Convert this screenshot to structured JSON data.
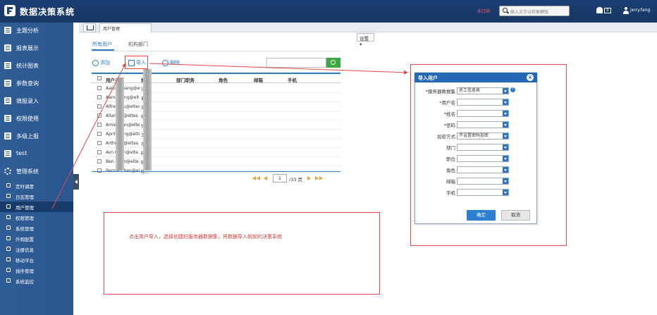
{
  "app": {
    "title": "数据决策系统"
  },
  "header": {
    "alert_text": "未订阅",
    "search_placeholder": "输入文字以检索模版",
    "notif_count": "0",
    "username": "jerry.fang"
  },
  "sidebar": {
    "items": [
      {
        "label": "主题分析"
      },
      {
        "label": "报表展示"
      },
      {
        "label": "统计图表"
      },
      {
        "label": "参数查询"
      },
      {
        "label": "填报录入"
      },
      {
        "label": "权限使用"
      },
      {
        "label": "多级上报"
      },
      {
        "label": "test"
      },
      {
        "label": "管理系统"
      }
    ],
    "subitems": [
      {
        "label": "定时调度"
      },
      {
        "label": "日志管理"
      },
      {
        "label": "用户管理"
      },
      {
        "label": "权限管理"
      },
      {
        "label": "系统管理"
      },
      {
        "label": "外观配置"
      },
      {
        "label": "注册信息"
      },
      {
        "label": "移动平台"
      },
      {
        "label": "插件管理"
      },
      {
        "label": "系统监控"
      }
    ]
  },
  "tabs": {
    "current": "用户管理"
  },
  "settings_label": "设置",
  "subtabs": {
    "all_users": "所有用户",
    "org_dept": "机构部门"
  },
  "toolbar": {
    "add": "添加",
    "import": "导入",
    "delete": "删除"
  },
  "table": {
    "headers": {
      "username": "用户名",
      "name": "姓名",
      "dept": "部门职务",
      "role": "角色",
      "email": "邮箱",
      "phone": "手机"
    },
    "rows": [
      {
        "username": "Aaron.Zhang@elt...",
        "name": "张..."
      },
      {
        "username": "Aaron.Yeng@elt...",
        "name": "黄..."
      },
      {
        "username": "Alfred.Liu@eltes...",
        "name": "刘..."
      },
      {
        "username": "Allan.Ng@eltes...",
        "name": "杨..."
      },
      {
        "username": "Amie.Qian@eltes...",
        "name": "钱..."
      },
      {
        "username": "April.Wang@eltes...",
        "name": "王..."
      },
      {
        "username": "Arthur.Li@eltes...",
        "name": "李..."
      },
      {
        "username": "Avn.Chen@elte...",
        "name": "陈..."
      },
      {
        "username": "Ben.Chen@elte...",
        "name": "陈..."
      },
      {
        "username": "Bernie.Chen@elt...",
        "name": "陈..."
      }
    ]
  },
  "pager": {
    "current": "1",
    "total_label": "/33 页"
  },
  "note": "点击用户导入，选择创建的服务器数据集，将数据导入帆软的决策系统",
  "dialog": {
    "title": "导入用户",
    "fields": [
      {
        "label": "*服务器数据集",
        "value": "员工信息表"
      },
      {
        "label": "*用户名",
        "value": ""
      },
      {
        "label": "*姓名",
        "value": ""
      },
      {
        "label": "*密码",
        "value": ""
      },
      {
        "label": "加密方式",
        "value": "不设置密码加密"
      },
      {
        "label": "部门",
        "value": ""
      },
      {
        "label": "职位",
        "value": ""
      },
      {
        "label": "角色",
        "value": ""
      },
      {
        "label": "邮箱",
        "value": ""
      },
      {
        "label": "手机",
        "value": ""
      }
    ],
    "ok": "确定",
    "cancel": "取消"
  },
  "colors": {
    "header_bg": "#1c3f73",
    "sidebar_bg": "#2f5d95",
    "accent": "#2a7ac8",
    "annotation": "#e04848",
    "search_green": "#3aa742"
  }
}
